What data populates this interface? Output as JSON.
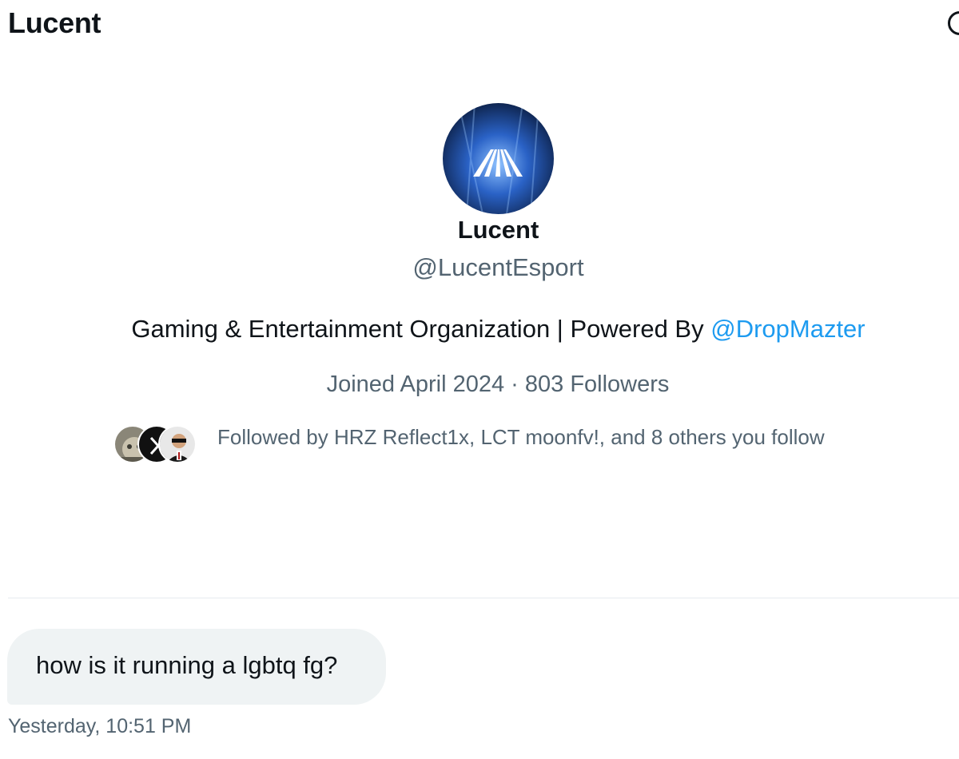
{
  "header": {
    "title": "Lucent",
    "info_icon": "info-circle-icon"
  },
  "profile": {
    "name": "Lucent",
    "handle": "@LucentEsport",
    "bio_text": "Gaming & Entertainment Organization | Powered By ",
    "bio_mention": "@DropMazter",
    "joined": "Joined April 2024",
    "separator": "·",
    "followers": "803 Followers",
    "followed_by": "Followed by HRZ Reflect1x, LCT moonfv!, and 8 others you follow",
    "avatar_colors": [
      "#0a1b3d",
      "#2a62c6",
      "#8fc2ff"
    ]
  },
  "conversation": {
    "messages": [
      {
        "text": "how is it running a lgbtq fg?",
        "time": "Yesterday, 10:51 PM"
      }
    ]
  },
  "colors": {
    "primary_text": "#0f1419",
    "secondary_text": "#536471",
    "link": "#1d9bf0",
    "bubble": "#eff3f4"
  }
}
